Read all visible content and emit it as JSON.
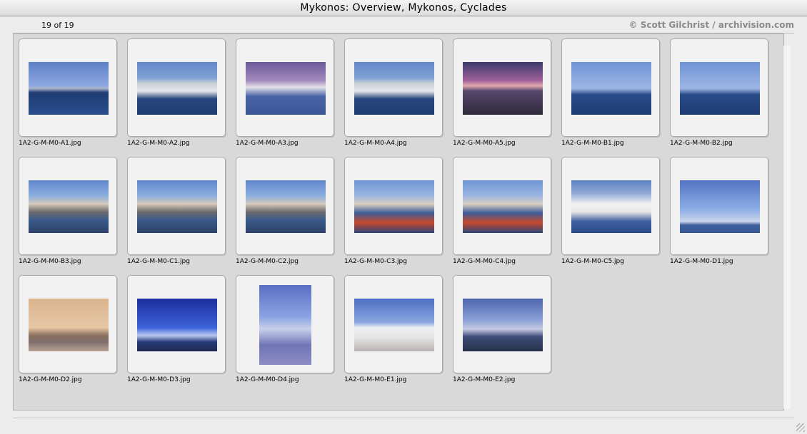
{
  "window": {
    "title": "Mykonos: Overview, Mykonos, Cyclades"
  },
  "info": {
    "counter": "19 of 19",
    "credit": "© Scott Gilchrist / archivision.com"
  },
  "images": [
    {
      "file": "1A2-G-M-M0-A1.jpg",
      "style": "harbor",
      "orientation": "land"
    },
    {
      "file": "1A2-G-M-M0-A2.jpg",
      "style": "town",
      "orientation": "land"
    },
    {
      "file": "1A2-G-M-M0-A3.jpg",
      "style": "dusk",
      "orientation": "land"
    },
    {
      "file": "1A2-G-M-M0-A4.jpg",
      "style": "town",
      "orientation": "land"
    },
    {
      "file": "1A2-G-M-M0-A5.jpg",
      "style": "sunset",
      "orientation": "land"
    },
    {
      "file": "1A2-G-M-M0-B1.jpg",
      "style": "boats",
      "orientation": "land"
    },
    {
      "file": "1A2-G-M-M0-B2.jpg",
      "style": "boats",
      "orientation": "land"
    },
    {
      "file": "1A2-G-M-M0-B3.jpg",
      "style": "busy",
      "orientation": "land"
    },
    {
      "file": "1A2-G-M-M0-C1.jpg",
      "style": "busy",
      "orientation": "land"
    },
    {
      "file": "1A2-G-M-M0-C2.jpg",
      "style": "busy",
      "orientation": "land"
    },
    {
      "file": "1A2-G-M-M0-C3.jpg",
      "style": "red",
      "orientation": "land"
    },
    {
      "file": "1A2-G-M-M0-C4.jpg",
      "style": "red",
      "orientation": "land"
    },
    {
      "file": "1A2-G-M-M0-C5.jpg",
      "style": "white",
      "orientation": "land"
    },
    {
      "file": "1A2-G-M-M0-D1.jpg",
      "style": "pale",
      "orientation": "land"
    },
    {
      "file": "1A2-G-M-M0-D2.jpg",
      "style": "warm",
      "orientation": "land"
    },
    {
      "file": "1A2-G-M-M0-D3.jpg",
      "style": "mill",
      "orientation": "land"
    },
    {
      "file": "1A2-G-M-M0-D4.jpg",
      "style": "mill-v",
      "orientation": "port"
    },
    {
      "file": "1A2-G-M-M0-E1.jpg",
      "style": "church",
      "orientation": "land"
    },
    {
      "file": "1A2-G-M-M0-E2.jpg",
      "style": "evening",
      "orientation": "land"
    }
  ]
}
